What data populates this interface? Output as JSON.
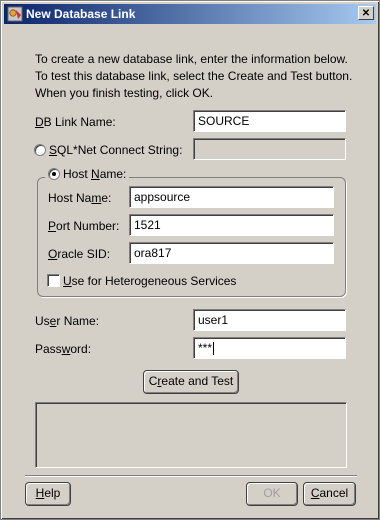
{
  "window": {
    "title": "New Database Link",
    "close_glyph": "✕"
  },
  "intro_text": "To create a new database link, enter the information below. To test this database link, select the Create and Test button. When you finish testing, click OK.",
  "db_link_name": {
    "label_u": "D",
    "label_rest": "B Link Name:",
    "value": "SOURCE"
  },
  "connect_string": {
    "label_u": "S",
    "label_rest": "QL*Net Connect String:",
    "value": "",
    "selected": false
  },
  "host_group": {
    "label_pre": "Host ",
    "label_u": "N",
    "label_post": "ame:",
    "selected": true,
    "host_name": {
      "label_pre": "Host Na",
      "label_u": "m",
      "label_post": "e:",
      "value": "appsource"
    },
    "port_number": {
      "label_u": "P",
      "label_rest": "ort Number:",
      "value": "1521"
    },
    "oracle_sid": {
      "label_u": "O",
      "label_rest": "racle SID:",
      "value": "ora817"
    },
    "heterogeneous": {
      "label_u": "U",
      "label_rest": "se for Heterogeneous Services",
      "checked": false
    }
  },
  "user_name": {
    "label_pre": "Us",
    "label_u": "e",
    "label_post": "r Name:",
    "value": "user1"
  },
  "password": {
    "label_pre": "Pass",
    "label_u": "w",
    "label_post": "ord:",
    "value": "***"
  },
  "buttons": {
    "create_test_pre": "C",
    "create_test_u": "r",
    "create_test_post": "eate and Test",
    "help_u": "H",
    "help_rest": "elp",
    "ok": "OK",
    "cancel_u": "C",
    "cancel_rest": "ancel"
  },
  "colors": {
    "titlebar_start": "#0a246a",
    "titlebar_end": "#a6caf0",
    "face": "#d4d0c8"
  }
}
